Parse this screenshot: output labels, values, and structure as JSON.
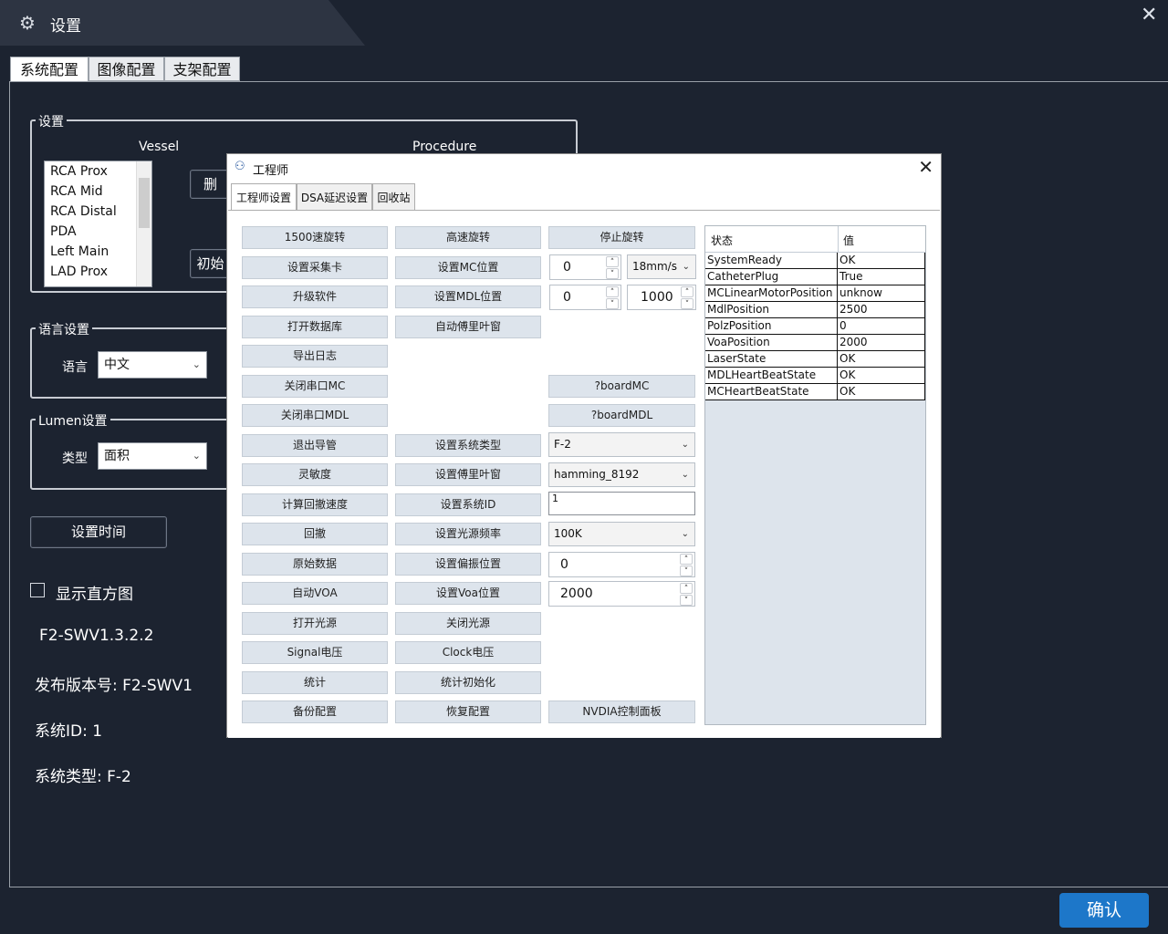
{
  "window": {
    "title": "设置",
    "close": "✕"
  },
  "tabs": [
    "系统配置",
    "图像配置",
    "支架配置"
  ],
  "settings": {
    "group_label": "设置",
    "vessel_label": "Vessel",
    "procedure_label": "Procedure",
    "vessels": [
      "RCA Prox",
      "RCA Mid",
      "RCA Distal",
      "PDA",
      "Left Main",
      "LAD Prox"
    ],
    "delete_btn": "删",
    "init_btn": "初始"
  },
  "language": {
    "group_label": "语言设置",
    "label": "语言",
    "value": "中文"
  },
  "lumen": {
    "group_label": "Lumen设置",
    "label": "类型",
    "value": "面积"
  },
  "set_time_btn": "设置时间",
  "histogram_label": "显示直方图",
  "info": {
    "version": "F2-SWV1.3.2.2",
    "release": "发布版本号: F2-SWV1",
    "system_id": "系统ID: 1",
    "system_type": "系统类型: F-2"
  },
  "ok_btn": "确认",
  "dialog": {
    "title": "工程师",
    "close": "✕",
    "tabs": [
      "工程师设置",
      "DSA延迟设置",
      "回收站"
    ],
    "col1": [
      "1500速旋转",
      "设置采集卡",
      "升级软件",
      "打开数据库",
      "导出日志",
      "关闭串口MC",
      "关闭串口MDL",
      "退出导管",
      "灵敏度",
      "计算回撤速度",
      "回撤",
      "原始数据",
      "自动VOA",
      "打开光源",
      "Signal电压",
      "统计",
      "备份配置"
    ],
    "col2": [
      "高速旋转",
      "设置MC位置",
      "设置MDL位置",
      "自动傅里叶窗",
      "设置系统类型",
      "设置傅里叶窗",
      "设置系统ID",
      "设置光源频率",
      "设置偏振位置",
      "设置Voa位置",
      "关闭光源",
      "Clock电压",
      "统计初始化",
      "恢复配置"
    ],
    "col3": {
      "stop_btn": "停止旋转",
      "mc_pos": "0",
      "speed": "18mm/s",
      "mdl_pos": "0",
      "mdl_val": "1000",
      "board_mc": "?boardMC",
      "board_mdl": "?boardMDL",
      "sys_type": "F-2",
      "fourier": "hamming_8192",
      "sys_id": "1",
      "light_freq": "100K",
      "polar": "0",
      "voa": "2000",
      "nvidia": "NVDIA控制面板"
    },
    "status": {
      "header_key": "状态",
      "header_val": "值",
      "rows": [
        [
          "SystemReady",
          "OK"
        ],
        [
          "CatheterPlug",
          "True"
        ],
        [
          "MCLinearMotorPosition",
          "unknow"
        ],
        [
          "MdlPosition",
          "2500"
        ],
        [
          "PolzPosition",
          "0"
        ],
        [
          "VoaPosition",
          "2000"
        ],
        [
          "LaserState",
          "OK"
        ],
        [
          "MDLHeartBeatState",
          "OK"
        ],
        [
          "MCHeartBeatState",
          "OK"
        ]
      ]
    }
  }
}
